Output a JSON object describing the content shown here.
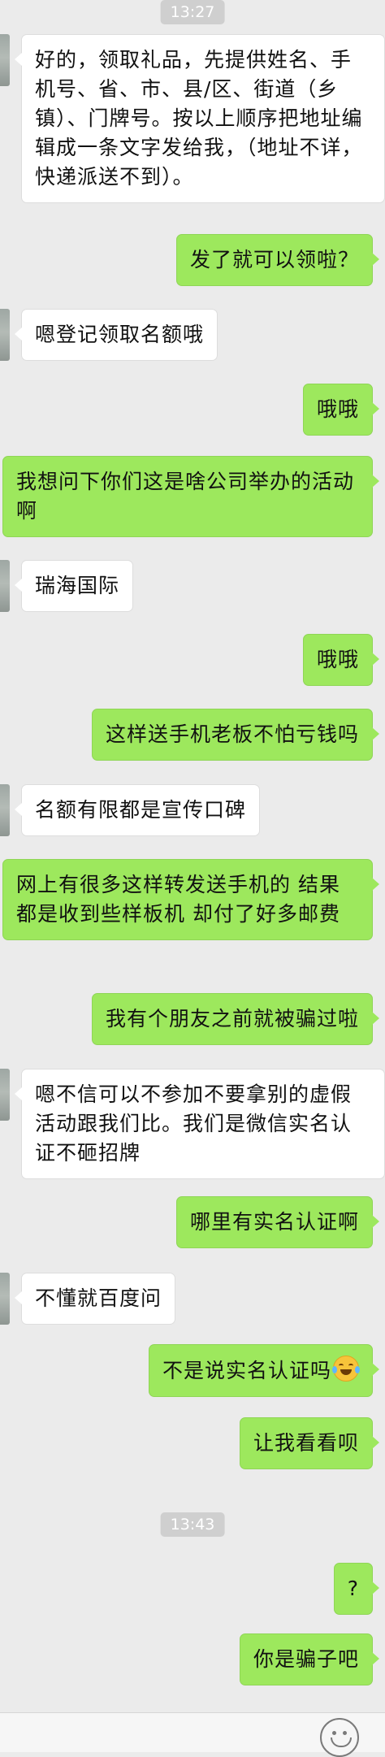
{
  "chat": {
    "time_top": "13:27",
    "time_mid": "13:43",
    "messages": [
      {
        "dir": "in",
        "text": "好的，领取礼品，先提供姓名、手机号、省、市、县/区、街道（乡镇）、门牌号。按以上顺序把地址编辑成一条文字发给我，（地址不详，快递派送不到）。"
      },
      {
        "dir": "out",
        "text": "发了就可以领啦？"
      },
      {
        "dir": "in",
        "text": "嗯登记领取名额哦"
      },
      {
        "dir": "out",
        "text": "哦哦"
      },
      {
        "dir": "out",
        "text": "我想问下你们这是啥公司举办的活动啊"
      },
      {
        "dir": "in",
        "text": "瑞海国际"
      },
      {
        "dir": "out",
        "text": "哦哦"
      },
      {
        "dir": "out",
        "text": "这样送手机老板不怕亏钱吗"
      },
      {
        "dir": "in",
        "text": "名额有限都是宣传口碑"
      },
      {
        "dir": "out",
        "text": "网上有很多这样转发送手机的 结果都是收到些样板机 却付了好多邮费"
      },
      {
        "dir": "out",
        "text": "我有个朋友之前就被骗过啦"
      },
      {
        "dir": "in",
        "text": "嗯不信可以不参加不要拿别的虚假活动跟我们比。我们是微信实名认证不砸招牌"
      },
      {
        "dir": "out",
        "text": "哪里有实名认证啊"
      },
      {
        "dir": "in",
        "text": "不懂就百度问"
      },
      {
        "dir": "out",
        "text": "不是说实名认证吗"
      },
      {
        "dir": "out",
        "text": "让我看看呗"
      },
      {
        "dir": "out",
        "text": "?"
      },
      {
        "dir": "out",
        "text": "你是骗子吧"
      }
    ]
  },
  "icons": {
    "laugh_emoji": "tears-of-joy-icon",
    "bottom_emoji": "emoji-face-icon"
  },
  "colors": {
    "background": "#ebebeb",
    "outgoing_bubble": "#9de85d",
    "incoming_bubble": "#ffffff",
    "timestamp_bg": "#cfcfcf"
  }
}
